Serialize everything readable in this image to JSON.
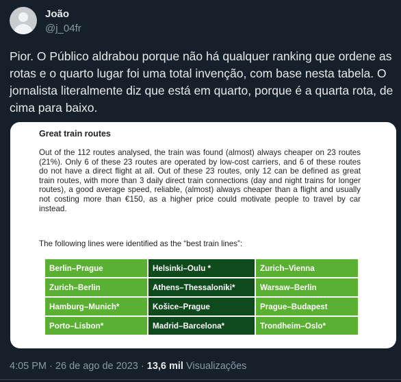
{
  "author": {
    "name": "João",
    "handle": "@j_04fr"
  },
  "tweet": {
    "text": "Pior. O Público aldrabou porque não há qualquer ranking que ordene as rotas e o quarto lugar foi uma total invenção, com base nesta tabela. O jornalista literalmente diz que está em quarto, porque é a quarta rota, de cima para baixo."
  },
  "card": {
    "title": "Great train routes",
    "paragraph": "Out of the 112 routes analysed, the train was found (almost) always cheaper on 23 routes (21%). Only 6 of these 23 routes are operated by low-cost carriers, and 6 of these routes do not have a direct flight at all. Out of these 23 routes, only 12 can be defined as great train routes, with more than 3 daily direct train connections (day and night trains for longer routes), a good average speed, reliable, (almost) always cheaper than a flight and usually not costing more than €150, as a higher price could motivate people to travel by car instead.",
    "lead": "The following lines were identified as the “best train lines”:",
    "routes": [
      [
        "Berlin–Prague",
        "Helsinki–Oulu *",
        "Zurich–Vienna"
      ],
      [
        "Zurich–Berlin",
        "Athens–Thessaloniki*",
        "Warsaw–Berlin"
      ],
      [
        "Hamburg–Munich*",
        "Košice–Prague",
        "Prague–Budapest"
      ],
      [
        "Porto–Lisbon*",
        "Madrid–Barcelona*",
        "Trondheim–Oslo*"
      ]
    ],
    "colors": {
      "light_green": "#5ab033",
      "dark_green": "#0f4a1c"
    }
  },
  "footer": {
    "time": "4:05 PM",
    "separator": "·",
    "date": "26 de ago de 2023",
    "views_count": "13,6 mil",
    "views_label": "Visualizações"
  }
}
